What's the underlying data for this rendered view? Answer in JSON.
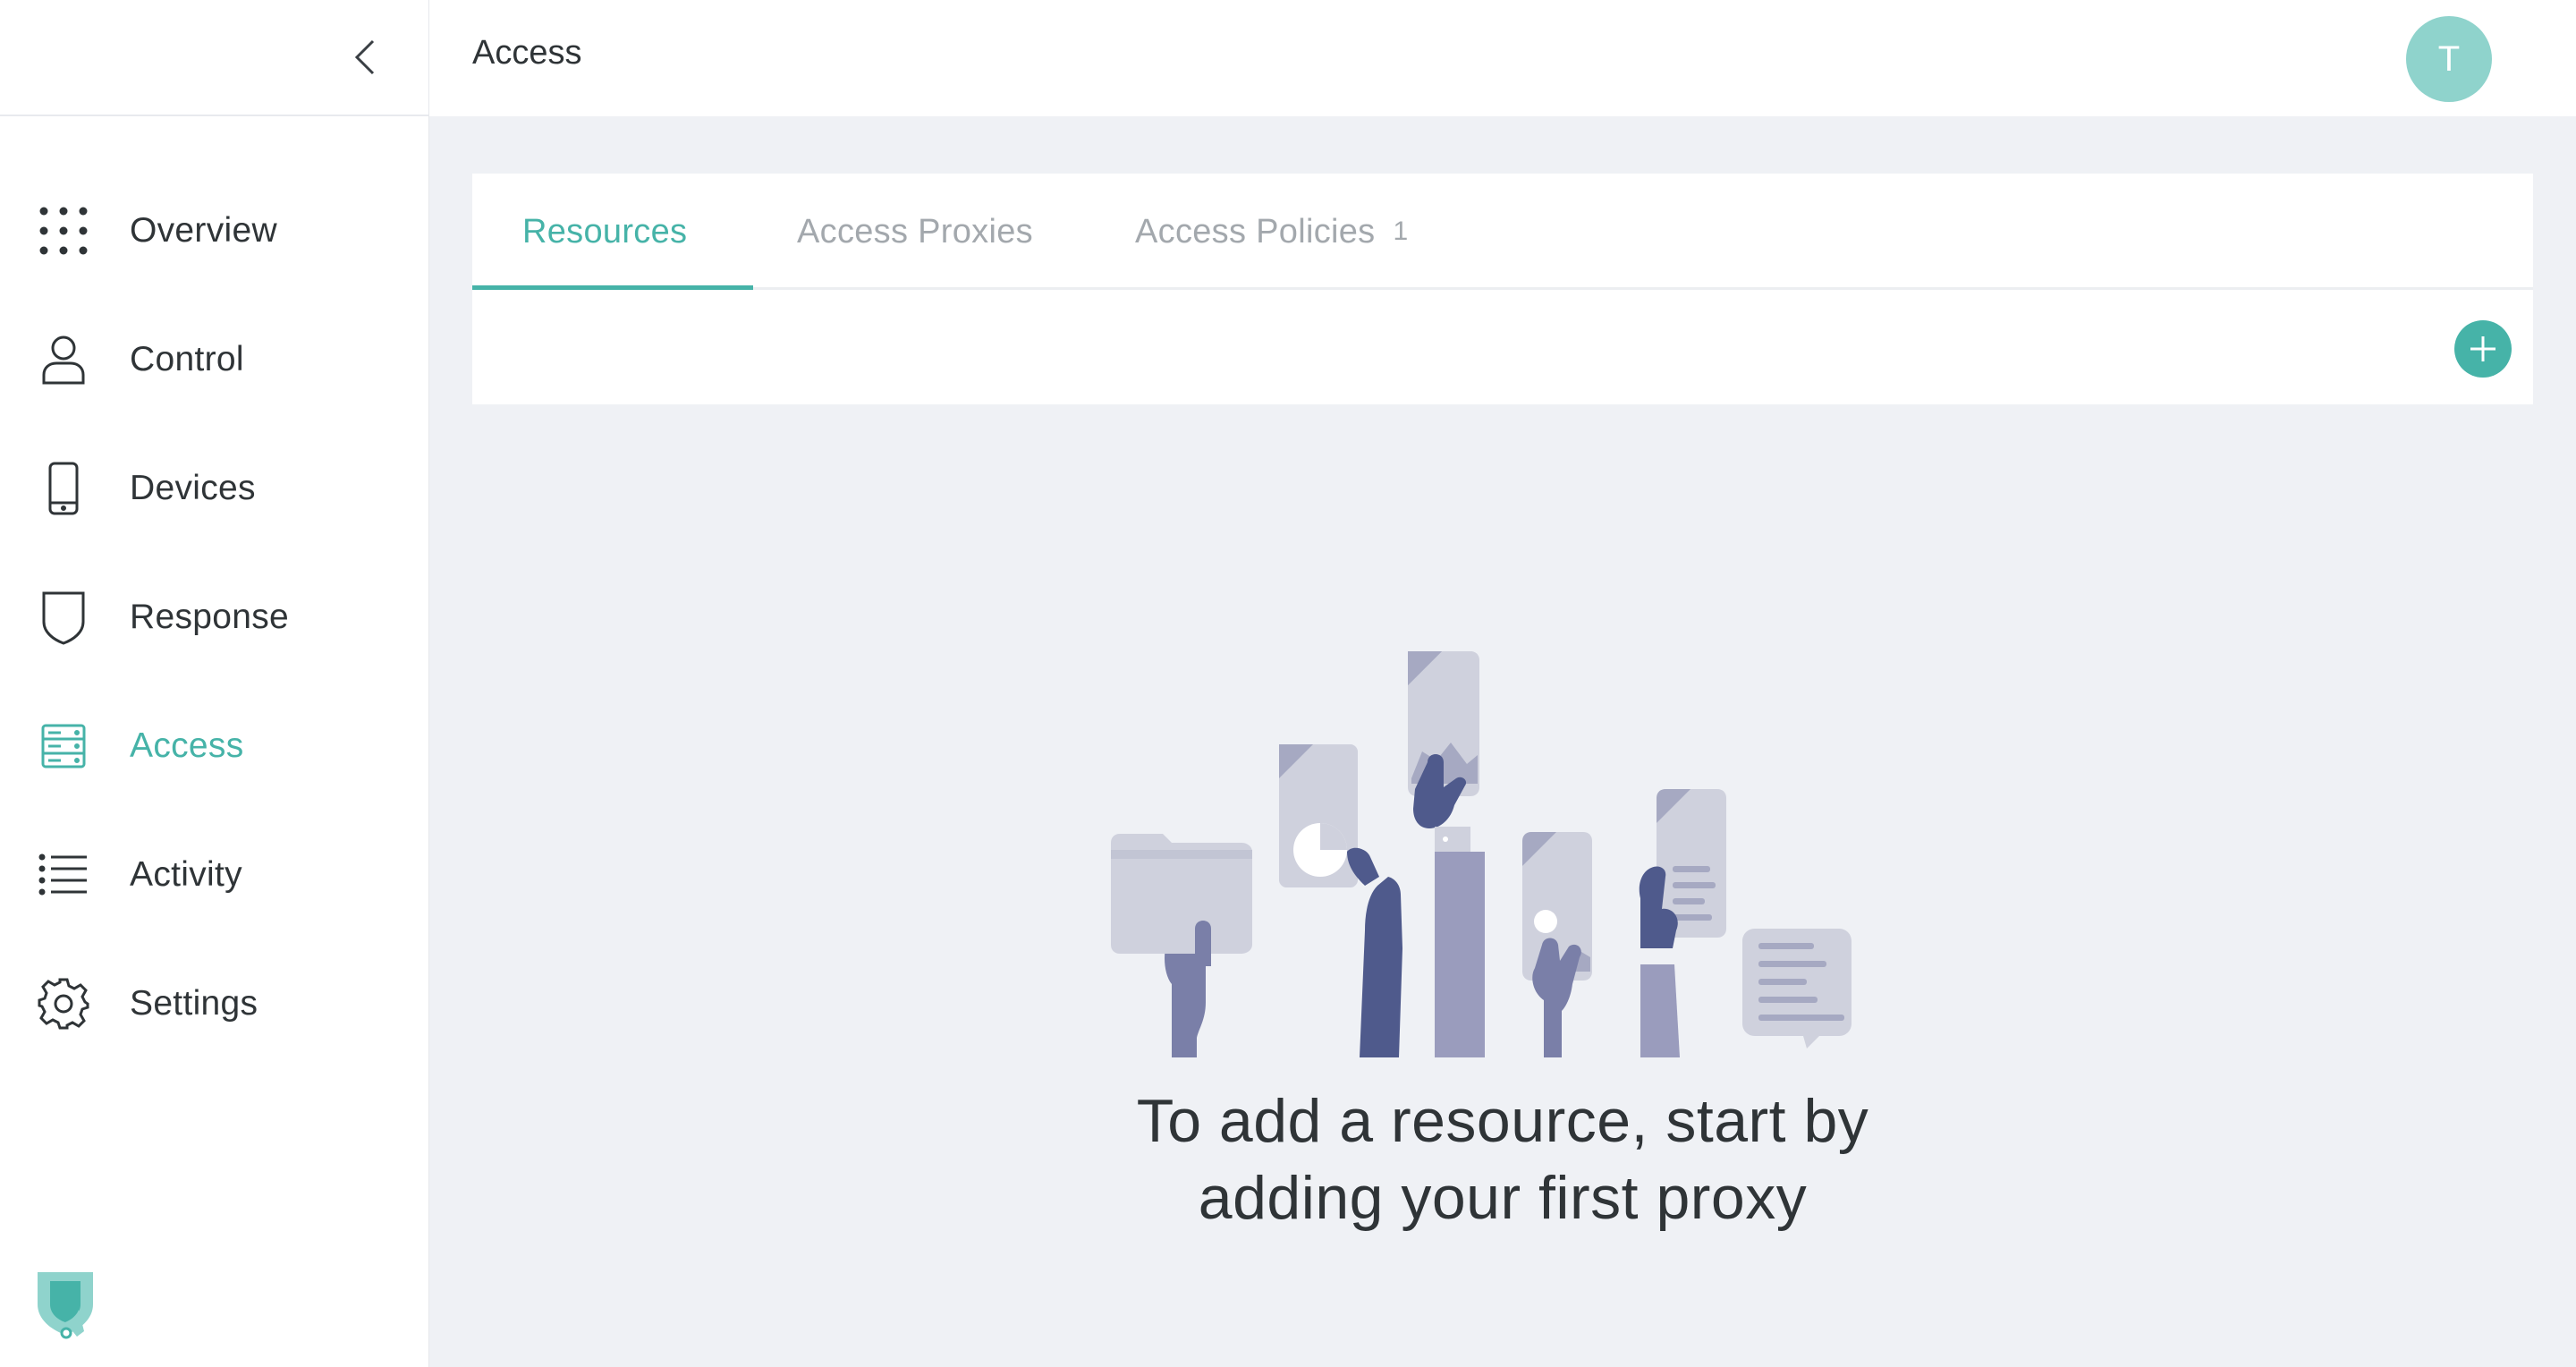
{
  "header": {
    "title": "Access",
    "avatar_initial": "T"
  },
  "sidebar": {
    "items": [
      {
        "label": "Overview",
        "icon": "grid-dots-icon"
      },
      {
        "label": "Control",
        "icon": "person-icon"
      },
      {
        "label": "Devices",
        "icon": "phone-icon"
      },
      {
        "label": "Response",
        "icon": "shield-icon"
      },
      {
        "label": "Access",
        "icon": "server-icon",
        "active": true
      },
      {
        "label": "Activity",
        "icon": "list-icon"
      },
      {
        "label": "Settings",
        "icon": "gear-icon"
      }
    ]
  },
  "tabs": [
    {
      "label": "Resources",
      "active": true
    },
    {
      "label": "Access Proxies"
    },
    {
      "label": "Access Policies",
      "count": "1"
    }
  ],
  "empty_state": {
    "line1": "To add a resource, start by",
    "line2": "adding your first proxy"
  },
  "colors": {
    "accent": "#46b3a8",
    "avatar": "#8fd3cc",
    "background": "#eff1f5",
    "illustration_dark": "#4f5a8c",
    "illustration_mid": "#7a7fa8",
    "illustration_light": "#cfd1dd"
  }
}
